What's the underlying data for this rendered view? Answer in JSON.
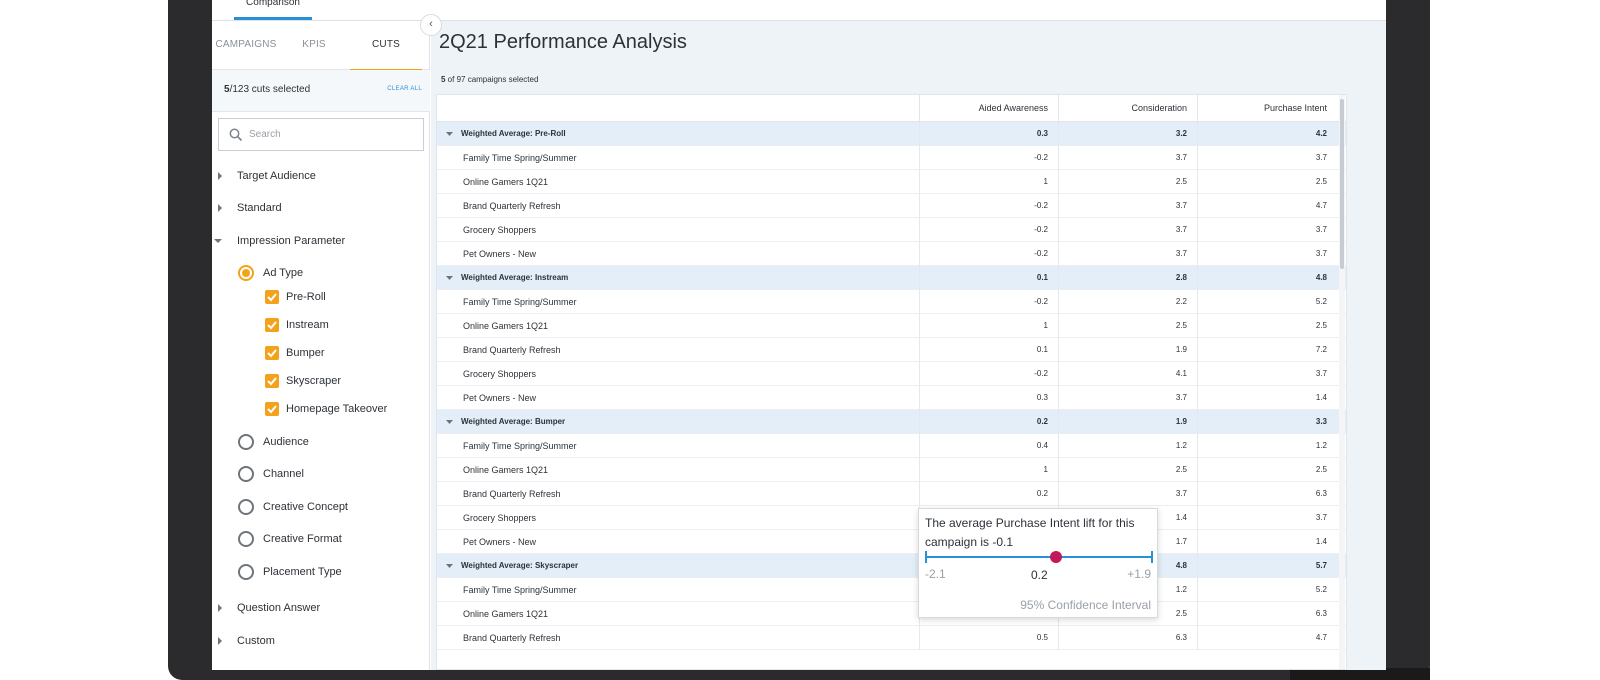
{
  "top_tab": "Comparison",
  "sidebar": {
    "tabs": [
      "CAMPAIGNS",
      "KPIS",
      "CUTS"
    ],
    "active_tab": "CUTS",
    "cuts_selected": "5",
    "cuts_total": "/123 cuts selected",
    "clear_all": "CLEAR ALL",
    "search_placeholder": "Search",
    "tree": {
      "target_audience": "Target Audience",
      "standard": "Standard",
      "impression_parameter": "Impression Parameter",
      "ad_type": "Ad Type",
      "ad_types": [
        "Pre-Roll",
        "Instream",
        "Bumper",
        "Skyscraper",
        "Homepage Takeover"
      ],
      "audience": "Audience",
      "channel": "Channel",
      "creative_concept": "Creative Concept",
      "creative_format": "Creative Format",
      "placement_type": "Placement Type",
      "question_answer": "Question Answer",
      "custom": "Custom"
    }
  },
  "main": {
    "title": "2Q21 Performance Analysis",
    "selected_count": "5",
    "selected_suffix": " of 97 campaigns selected",
    "columns": [
      "Aided Awareness",
      "Consideration",
      "Purchase Intent"
    ],
    "rows": [
      {
        "group": true,
        "label": "Weighted Average:   Pre-Roll",
        "values": [
          "0.3",
          "3.2",
          "4.2"
        ]
      },
      {
        "group": false,
        "label": "Family Time Spring/Summer",
        "values": [
          "-0.2",
          "3.7",
          "3.7"
        ]
      },
      {
        "group": false,
        "label": "Online Gamers 1Q21",
        "values": [
          "1",
          "2.5",
          "2.5"
        ]
      },
      {
        "group": false,
        "label": "Brand Quarterly Refresh",
        "values": [
          "-0.2",
          "3.7",
          "4.7"
        ]
      },
      {
        "group": false,
        "label": "Grocery Shoppers",
        "values": [
          "-0.2",
          "3.7",
          "3.7"
        ]
      },
      {
        "group": false,
        "label": "Pet Owners - New",
        "values": [
          "-0.2",
          "3.7",
          "3.7"
        ]
      },
      {
        "group": true,
        "label": "Weighted Average:   Instream",
        "values": [
          "0.1",
          "2.8",
          "4.8"
        ]
      },
      {
        "group": false,
        "label": "Family Time Spring/Summer",
        "values": [
          "-0.2",
          "2.2",
          "5.2"
        ]
      },
      {
        "group": false,
        "label": "Online Gamers 1Q21",
        "values": [
          "1",
          "2.5",
          "2.5"
        ]
      },
      {
        "group": false,
        "label": "Brand Quarterly Refresh",
        "values": [
          "0.1",
          "1.9",
          "7.2"
        ]
      },
      {
        "group": false,
        "label": "Grocery Shoppers",
        "values": [
          "-0.2",
          "4.1",
          "3.7"
        ]
      },
      {
        "group": false,
        "label": "Pet Owners - New",
        "values": [
          "0.3",
          "3.7",
          "1.4"
        ]
      },
      {
        "group": true,
        "label": "Weighted Average:   Bumper",
        "values": [
          "0.2",
          "1.9",
          "3.3"
        ]
      },
      {
        "group": false,
        "label": "Family Time Spring/Summer",
        "values": [
          "0.4",
          "1.2",
          "1.2"
        ]
      },
      {
        "group": false,
        "label": "Online Gamers 1Q21",
        "values": [
          "1",
          "2.5",
          "2.5"
        ]
      },
      {
        "group": false,
        "label": "Brand Quarterly Refresh",
        "values": [
          "0.2",
          "3.7",
          "6.3"
        ]
      },
      {
        "group": false,
        "label": "Grocery Shoppers",
        "values": [
          "",
          "1.4",
          "3.7"
        ]
      },
      {
        "group": false,
        "label": "Pet Owners - New",
        "values": [
          "",
          "1.7",
          "1.4"
        ]
      },
      {
        "group": true,
        "label": "Weighted Average:   Skyscraper",
        "values": [
          "",
          "4.8",
          "5.7"
        ]
      },
      {
        "group": false,
        "label": "Family Time Spring/Summer",
        "values": [
          "",
          "1.2",
          "5.2"
        ]
      },
      {
        "group": false,
        "label": "Online Gamers 1Q21",
        "values": [
          "",
          "2.5",
          "6.3"
        ]
      },
      {
        "group": false,
        "label": "Brand Quarterly Refresh",
        "values": [
          "0.5",
          "6.3",
          "4.7"
        ]
      }
    ]
  },
  "tooltip": {
    "text": "The average Purchase Intent lift for this campaign is -0.1",
    "low": "-2.1",
    "point": "0.2",
    "high": "+1.9",
    "ci_label": "95% Confidence Interval"
  },
  "colors": {
    "accent_orange": "#f5a21b",
    "accent_blue": "#2b8fd6",
    "group_row": "#e3eef8",
    "point_marker": "#c2185b"
  }
}
